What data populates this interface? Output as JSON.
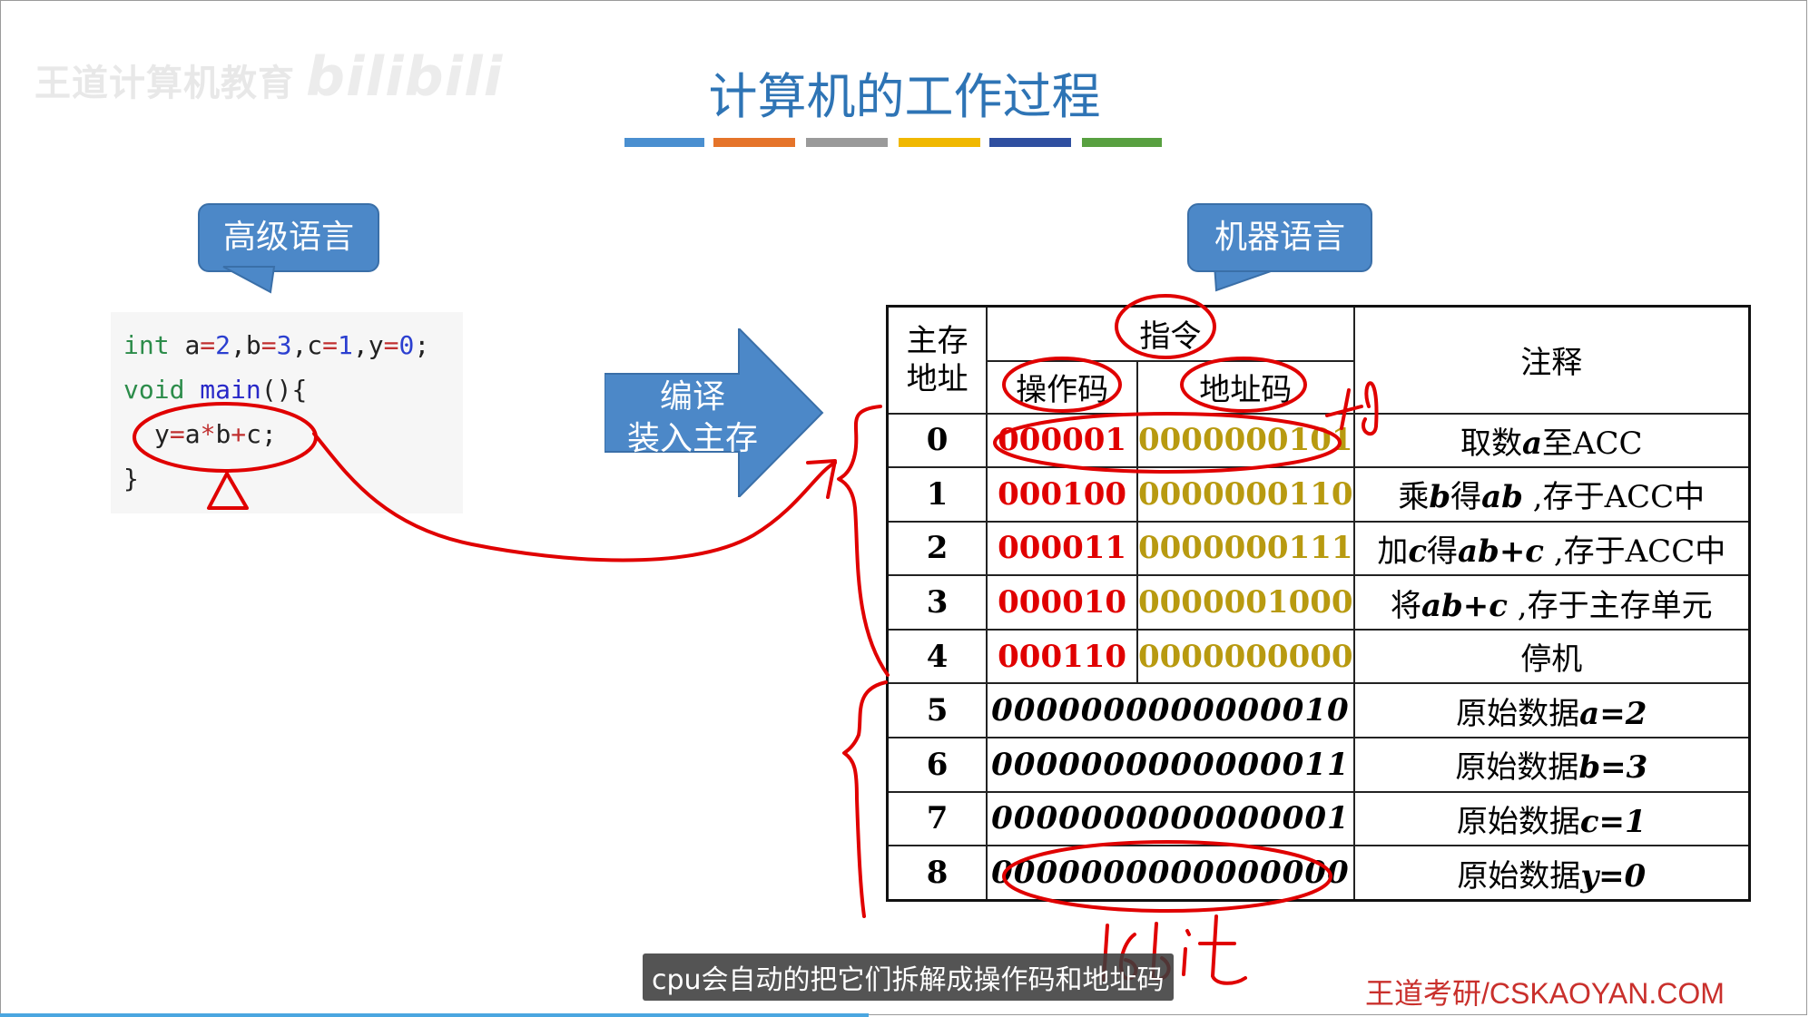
{
  "watermark": {
    "text": "王道计算机教育",
    "logo": "bilibili"
  },
  "title": "计算机的工作过程",
  "colors": {
    "title": "#2e74b5",
    "bubble": "#4c88c8",
    "opcode": "#e00000",
    "address": "#b89a10",
    "ink": "#e00000",
    "bars": [
      "#4a8fd0",
      "#e5742a",
      "#9a9a9a",
      "#f0b800",
      "#2f4fa0",
      "#58a040"
    ]
  },
  "bubbles": {
    "high_level": "高级语言",
    "machine": "机器语言"
  },
  "code": {
    "line1": {
      "kw": "int",
      "rest_pre": "a",
      "op1": "=",
      "n1": "2",
      "s1": ",b",
      "op2": "=",
      "n2": "3",
      "s2": ",c",
      "op3": "=",
      "n3": "1",
      "s3": ",y",
      "op4": "=",
      "n4": "0",
      "end": ";"
    },
    "line2": {
      "kw": "void",
      "fn": "main",
      "end": "(){"
    },
    "line3": {
      "pre": "y",
      "op1": "=",
      "a": "a",
      "op2": "*",
      "b": "b",
      "op3": "+",
      "c": "c;"
    },
    "line4": "}"
  },
  "arrow": {
    "line1": "编译",
    "line2": "装入主存"
  },
  "table": {
    "headers": {
      "address": "主存\n地址",
      "address_l1": "主存",
      "address_l2": "地址",
      "instruction": "指令",
      "opcode": "操作码",
      "addr_code": "地址码",
      "note": "注释"
    },
    "instr_rows": [
      {
        "addr": "0",
        "opcode": "000001",
        "addrcode": "0000000101",
        "note_pre": "取数",
        "note_var": "a",
        "note_post": "至ACC"
      },
      {
        "addr": "1",
        "opcode": "000100",
        "addrcode": "0000000110",
        "note_pre": "乘",
        "note_var": "b",
        "note_mid": "得",
        "note_var2": "ab",
        "note_post": " ,存于ACC中"
      },
      {
        "addr": "2",
        "opcode": "000011",
        "addrcode": "0000000111",
        "note_pre": "加",
        "note_var": "c",
        "note_mid": "得",
        "note_var2": "ab+c",
        "note_post": " ,存于ACC中"
      },
      {
        "addr": "3",
        "opcode": "000010",
        "addrcode": "0000001000",
        "note_pre": "将",
        "note_var": "ab+c",
        "note_post": " ,存于主存单元"
      },
      {
        "addr": "4",
        "opcode": "000110",
        "addrcode": "0000000000",
        "note_pre": "停机",
        "note_var": "",
        "note_post": ""
      }
    ],
    "data_rows": [
      {
        "addr": "5",
        "word": "0000000000000010",
        "note_pre": "原始数据",
        "note_var": "a=2"
      },
      {
        "addr": "6",
        "word": "0000000000000011",
        "note_pre": "原始数据",
        "note_var": "b=3"
      },
      {
        "addr": "7",
        "word": "0000000000000001",
        "note_pre": "原始数据",
        "note_var": "c=1"
      },
      {
        "addr": "8",
        "word": "0000000000000000",
        "note_pre": "原始数据",
        "note_var": "y=0"
      }
    ]
  },
  "annotations": {
    "bits": "16bit",
    "plus": "+6"
  },
  "subtitle": "cpu会自动的把它们拆解成操作码和地址码",
  "brand": "王道考研/CSKAOYAN.COM",
  "progress": 0.48
}
